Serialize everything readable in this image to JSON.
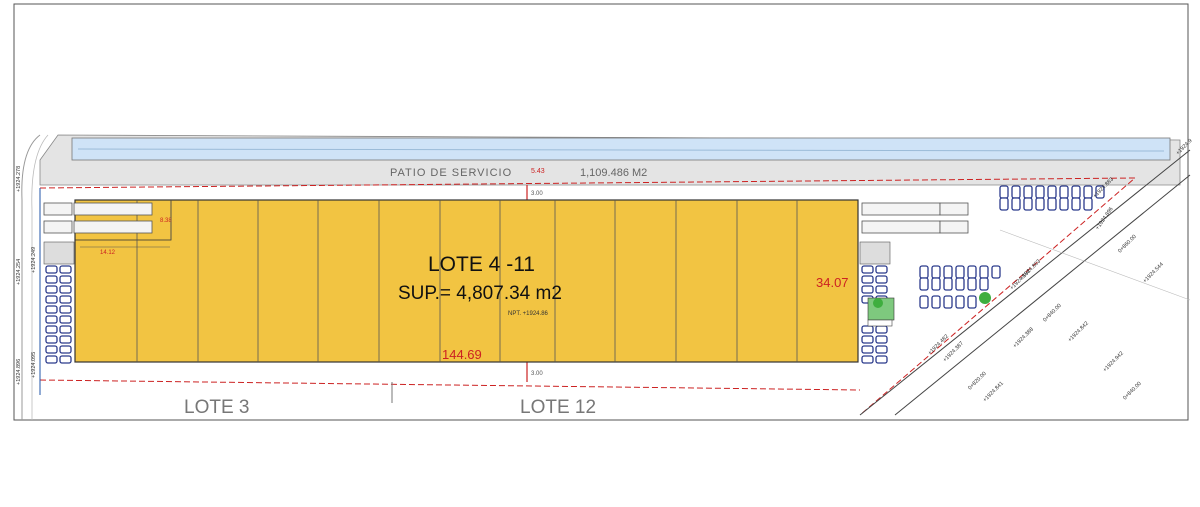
{
  "lot": {
    "title": "LOTE  4 -11",
    "area": "SUP.= 4,807.34 m2",
    "level": "NPT. +1924.86"
  },
  "service_yard": {
    "name": "PATIO DE SERVICIO",
    "area": "1,109.486 M2"
  },
  "neighbors": {
    "left": "LOTE 3",
    "right": "LOTE 12"
  },
  "dimensions": {
    "length": "144.69",
    "depth": "34.07",
    "yard_depth": "5.43",
    "setback_top": "3.00",
    "setback_bottom": "3.00",
    "office_w": "14.12",
    "office_h": "8.38"
  },
  "elevations": {
    "left_1": "+1924.278",
    "left_2": "+1924.249",
    "left_3": "+1924.254",
    "left_4": "+1924.095",
    "left_5": "+1924.896",
    "top_right": "+1924.9",
    "r1": "+1924.896",
    "r2": "+1924.883",
    "r3": "+1924.864",
    "r4": "+1924.863",
    "r5": "+1924.482",
    "r6": "+1924.387",
    "r7": "+1924.388",
    "r8": "+1924.842",
    "r9": "+1924.942",
    "r10": "+1924.841",
    "r11": "+1924.544",
    "s1": "0+840.00",
    "s2": "0+820.00",
    "s3": "0+840.00",
    "s4": "0+860.00"
  },
  "colors": {
    "building": "#f2c442",
    "yard": "#e4e4e4",
    "canal": "#cfe3f7",
    "parking": "#2b3a8c",
    "boundary": "#cc2222",
    "tree": "#3fae3f"
  }
}
